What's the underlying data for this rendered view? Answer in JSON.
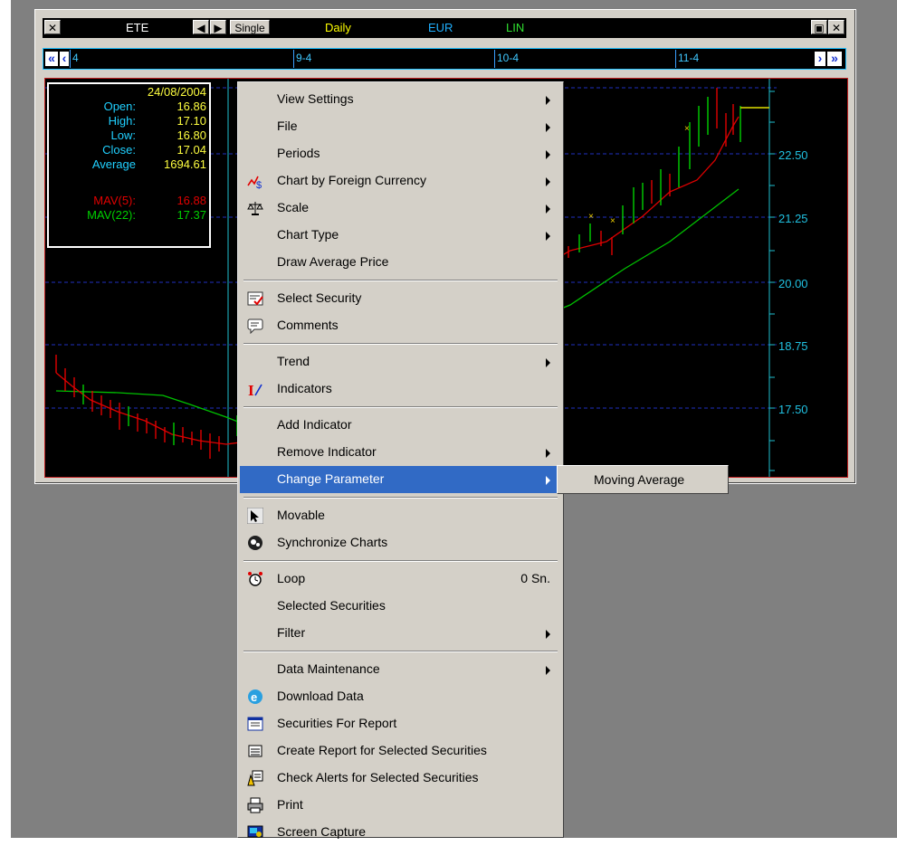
{
  "toolbar": {
    "symbol": "ETE",
    "mode": "Single",
    "period": "Daily",
    "currency": "EUR",
    "scale": "LIN"
  },
  "timeline": {
    "ticks": [
      "4",
      "9-4",
      "10-4",
      "11-4"
    ]
  },
  "info_panel": {
    "date": "24/08/2004",
    "rows": [
      {
        "label": "Open:",
        "value": "16.86"
      },
      {
        "label": "High:",
        "value": "17.10"
      },
      {
        "label": "Low:",
        "value": "16.80"
      },
      {
        "label": "Close:",
        "value": "17.04"
      },
      {
        "label": "Average",
        "value": "1694.61"
      }
    ],
    "mav": [
      {
        "label": "MAV(5):",
        "value": "16.88"
      },
      {
        "label": "MAV(22):",
        "value": "17.37"
      }
    ]
  },
  "chart_data": {
    "type": "line",
    "y_tick_labels": [
      "22.50",
      "21.25",
      "20.00",
      "18.75",
      "17.50"
    ],
    "series_colors": {
      "mav5": "#e00000",
      "mav22": "#00c000",
      "up": "#00d000",
      "down": "#e00000"
    }
  },
  "menu": {
    "items": [
      {
        "label": "View Settings",
        "arrow": true
      },
      {
        "label": "File",
        "arrow": true
      },
      {
        "label": "Periods",
        "arrow": true
      },
      {
        "label": "Chart by Foreign Currency",
        "arrow": true,
        "icon": "currency-chart-icon"
      },
      {
        "label": "Scale",
        "arrow": true,
        "icon": "scale-icon"
      },
      {
        "label": "Chart Type",
        "arrow": true
      },
      {
        "label": "Draw Average Price"
      },
      {
        "label": "Select Security",
        "icon": "select-security-icon"
      },
      {
        "label": "Comments",
        "icon": "comments-icon"
      },
      {
        "label": "Trend",
        "arrow": true
      },
      {
        "label": "Indicators",
        "icon": "indicators-icon"
      },
      {
        "label": "Add Indicator"
      },
      {
        "label": "Remove Indicator",
        "arrow": true
      },
      {
        "label": "Change Parameter",
        "arrow": true,
        "highlighted": true
      },
      {
        "label": "Movable",
        "icon": "cursor-icon"
      },
      {
        "label": "Synchronize Charts",
        "icon": "sync-icon"
      },
      {
        "label": "Loop",
        "icon": "alarm-clock-icon",
        "right": "0 Sn."
      },
      {
        "label": "Selected Securities"
      },
      {
        "label": "Filter",
        "arrow": true
      },
      {
        "label": "Data Maintenance",
        "arrow": true
      },
      {
        "label": "Download Data",
        "icon": "download-icon"
      },
      {
        "label": "Securities For Report",
        "icon": "report-icon"
      },
      {
        "label": "Create Report for Selected Securities",
        "icon": "list-icon"
      },
      {
        "label": "Check Alerts for Selected Securities",
        "icon": "alert-icon"
      },
      {
        "label": "Print",
        "icon": "printer-icon"
      },
      {
        "label": "Screen Capture",
        "icon": "screen-capture-icon"
      }
    ]
  },
  "submenu": {
    "label": "Moving Average"
  }
}
